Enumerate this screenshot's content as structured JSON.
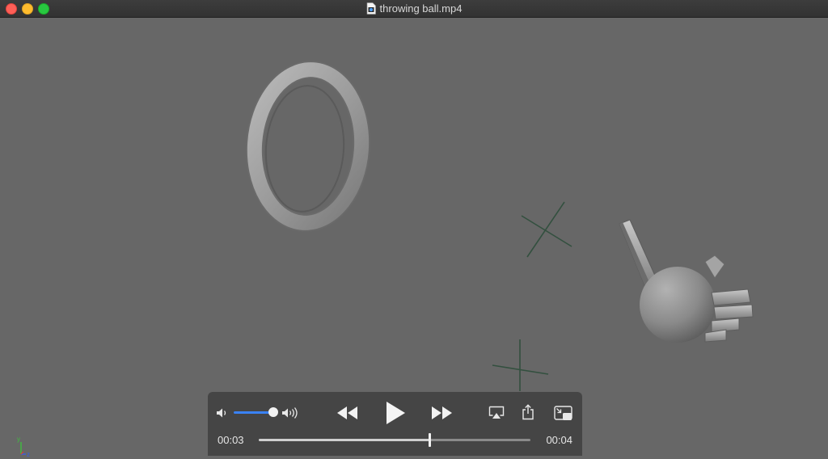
{
  "window": {
    "title": "throwing ball.mp4"
  },
  "axis_gizmo": {
    "y_label": "y",
    "z_label": "z"
  },
  "player": {
    "current_time": "00:03",
    "total_time": "00:04",
    "progress_fraction": 0.63,
    "volume_fraction": 1.0,
    "accent_color": "#3a82f6"
  },
  "icons": {
    "volume_low": "speaker-low-icon",
    "volume_high": "speaker-high-icon",
    "rewind": "rewind-icon",
    "play": "play-icon",
    "fast_forward": "fast-forward-icon",
    "airplay": "airplay-icon",
    "share": "share-icon",
    "pip": "picture-in-picture-icon"
  }
}
